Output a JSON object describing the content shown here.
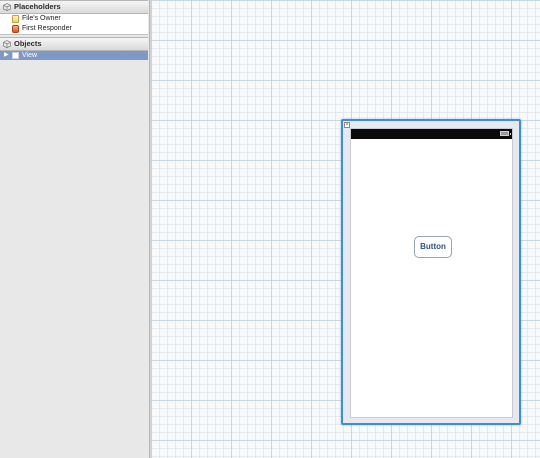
{
  "outline": {
    "placeholders": {
      "title": "Placeholders",
      "icon": "cube-icon",
      "items": [
        {
          "label": "File's Owner",
          "icon": "files-owner-icon"
        },
        {
          "label": "First Responder",
          "icon": "first-responder-icon"
        }
      ]
    },
    "objects": {
      "title": "Objects",
      "icon": "cube-icon",
      "items": [
        {
          "label": "View",
          "icon": "view-icon",
          "selected": true
        }
      ]
    }
  },
  "canvas": {
    "view": {
      "button_label": "Button",
      "selection_color": "#3f8ed4",
      "status_bar_color": "#0a0a0a"
    }
  },
  "colors": {
    "selection_row": "#7f99c4",
    "panel_bg": "#e8e8e8"
  }
}
